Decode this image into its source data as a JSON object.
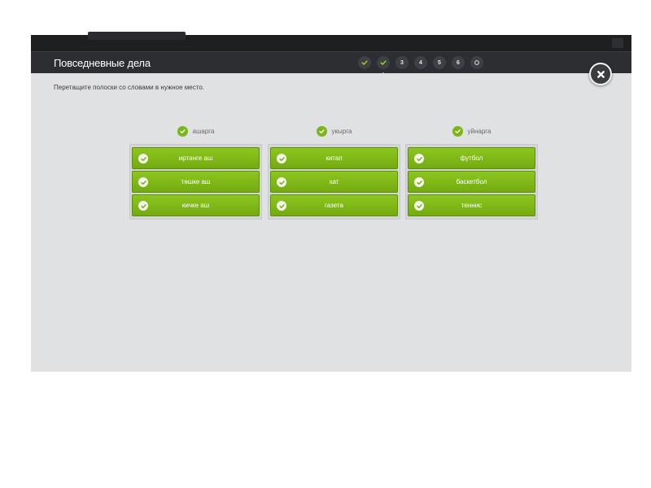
{
  "header": {
    "title": "Повседневные дела"
  },
  "steps": [
    {
      "label": "",
      "state": "done",
      "icon": "check-icon"
    },
    {
      "label": "",
      "state": "done-current",
      "icon": "check-icon"
    },
    {
      "label": "3",
      "state": "pending"
    },
    {
      "label": "4",
      "state": "pending"
    },
    {
      "label": "5",
      "state": "pending"
    },
    {
      "label": "6",
      "state": "pending"
    },
    {
      "label": "",
      "state": "pending",
      "icon": "finish-circle-icon"
    }
  ],
  "instruction": "Перетащите полоски со словами в нужное место.",
  "close": {
    "icon": "close-icon"
  },
  "columns": [
    {
      "title": "ашарга",
      "items": [
        "иртәнге аш",
        "төшке аш",
        "кичке аш"
      ]
    },
    {
      "title": "укырга",
      "items": [
        "китап",
        "хат",
        "газета"
      ]
    },
    {
      "title": "уйнарга",
      "items": [
        "футбол",
        "баскетбол",
        "теннис"
      ]
    }
  ],
  "colors": {
    "accent_green": "#7cb518",
    "header_bg": "#2c2e31",
    "content_bg": "#e0e1e2"
  }
}
